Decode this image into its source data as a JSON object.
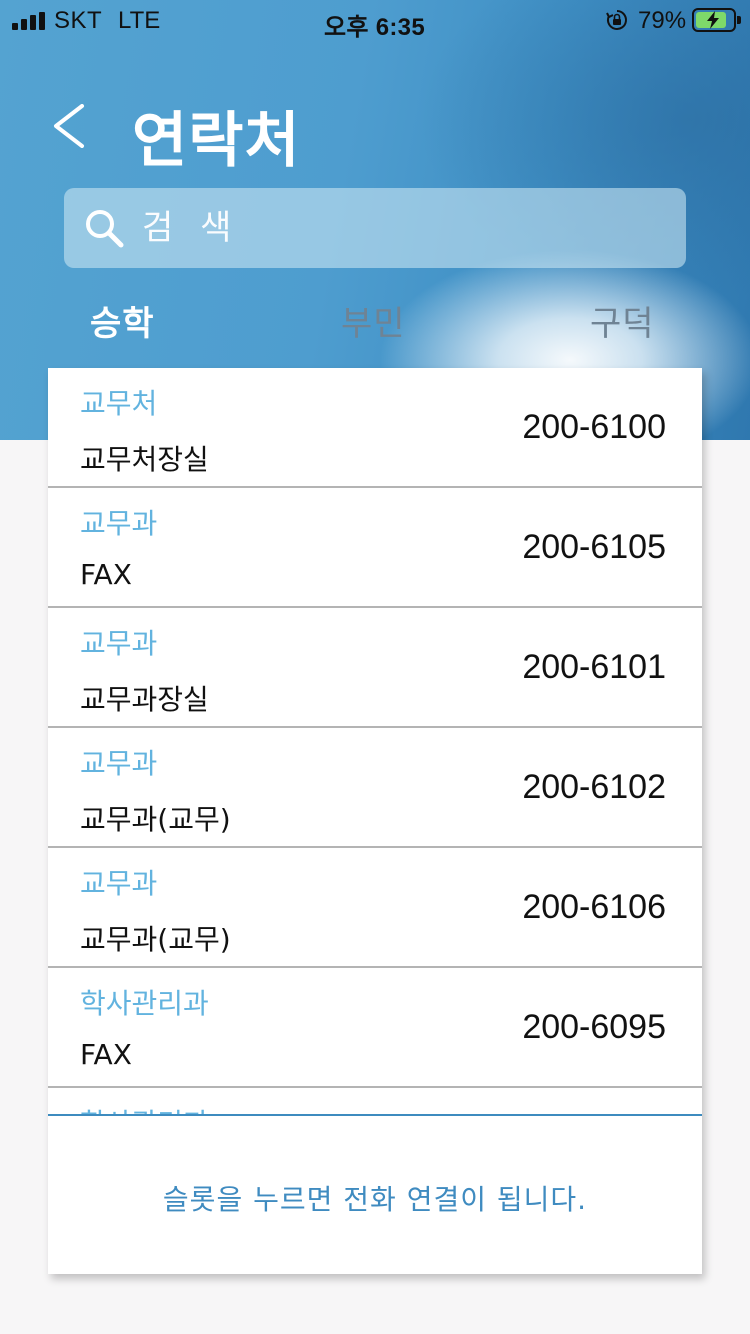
{
  "status_bar": {
    "carrier": "SKT",
    "network": "LTE",
    "time": "오후 6:35",
    "battery_percent": "79%",
    "battery_level": 0.79,
    "battery_charging": true,
    "rotation_lock": true
  },
  "header": {
    "back_icon": "chevron-left-icon",
    "title": "연락처"
  },
  "search": {
    "placeholder": "검 색",
    "value": "",
    "icon": "search-icon"
  },
  "tabs": [
    {
      "label": "승학",
      "active": true
    },
    {
      "label": "부민",
      "active": false
    },
    {
      "label": "구덕",
      "active": false
    }
  ],
  "contacts": [
    {
      "department": "교무처",
      "description": "교무처장실",
      "phone": "200-6100"
    },
    {
      "department": "교무과",
      "description": "FAX",
      "phone": "200-6105"
    },
    {
      "department": "교무과",
      "description": "교무과장실",
      "phone": "200-6101"
    },
    {
      "department": "교무과",
      "description": "교무과(교무)",
      "phone": "200-6102"
    },
    {
      "department": "교무과",
      "description": "교무과(교무)",
      "phone": "200-6106"
    },
    {
      "department": "학사관리과",
      "description": "FAX",
      "phone": "200-6095"
    },
    {
      "department": "학사관리과",
      "description": "",
      "phone": ""
    }
  ],
  "footer": {
    "hint": "슬롯을 누르면 전화 연결이 됩니다."
  },
  "colors": {
    "header_blue": "#4e9dcf",
    "department_blue": "#62b3df",
    "footer_blue": "#3f8bc0",
    "divider_gray": "#b4b4b4",
    "tab_inactive": "#6f8394"
  }
}
